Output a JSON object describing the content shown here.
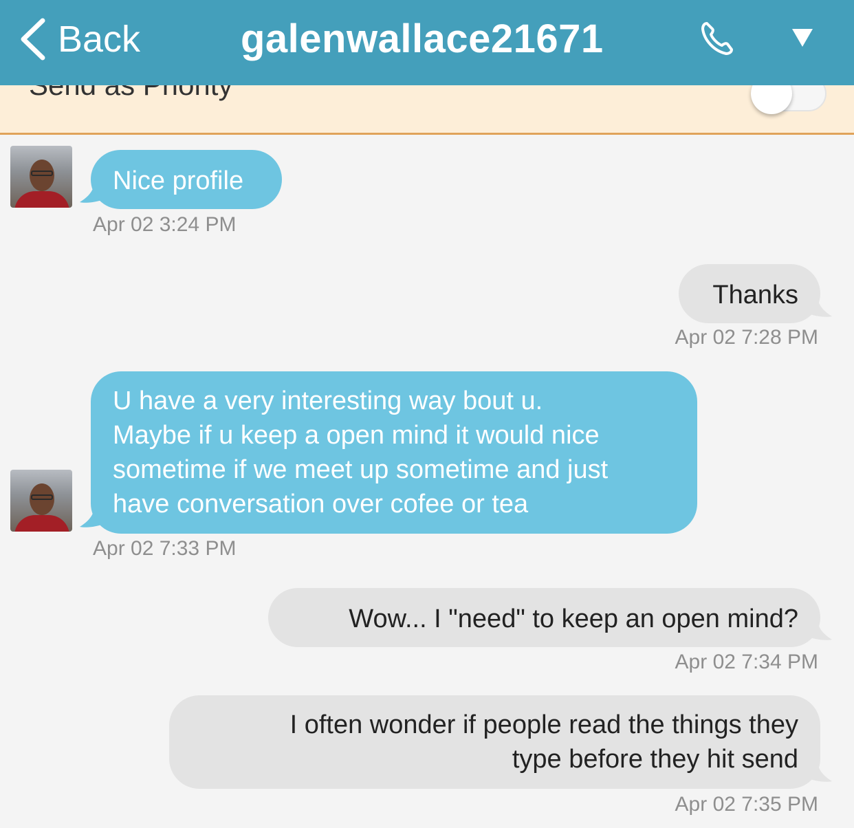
{
  "header": {
    "back_label": "Back",
    "title": "galenwallace21671",
    "colors": {
      "bar": "#449fbb",
      "text": "#ffffff"
    }
  },
  "priority": {
    "label": "Send as Priority",
    "toggle_on": false
  },
  "messages": [
    {
      "direction": "incoming",
      "text": "Nice profile",
      "time": "Apr 02 3:24 PM"
    },
    {
      "direction": "outgoing",
      "text": "Thanks",
      "time": "Apr 02 7:28 PM"
    },
    {
      "direction": "incoming",
      "text": "U have a very interesting way bout u.\nMaybe if u keep a open mind it would nice\nsometime if we meet up sometime and just\nhave conversation over cofee or tea",
      "time": "Apr 02 7:33 PM"
    },
    {
      "direction": "outgoing",
      "text": "Wow... I \"need\" to keep an open mind?",
      "time": "Apr 02 7:34 PM"
    },
    {
      "direction": "outgoing",
      "text": "I often wonder if people read the things they\ntype before they hit send",
      "time": "Apr 02 7:35 PM"
    }
  ],
  "colors": {
    "incoming_bubble": "#6ec5e1",
    "outgoing_bubble": "#e3e3e3",
    "priority_bg": "#fdeed8",
    "priority_border": "#e0a35a"
  }
}
